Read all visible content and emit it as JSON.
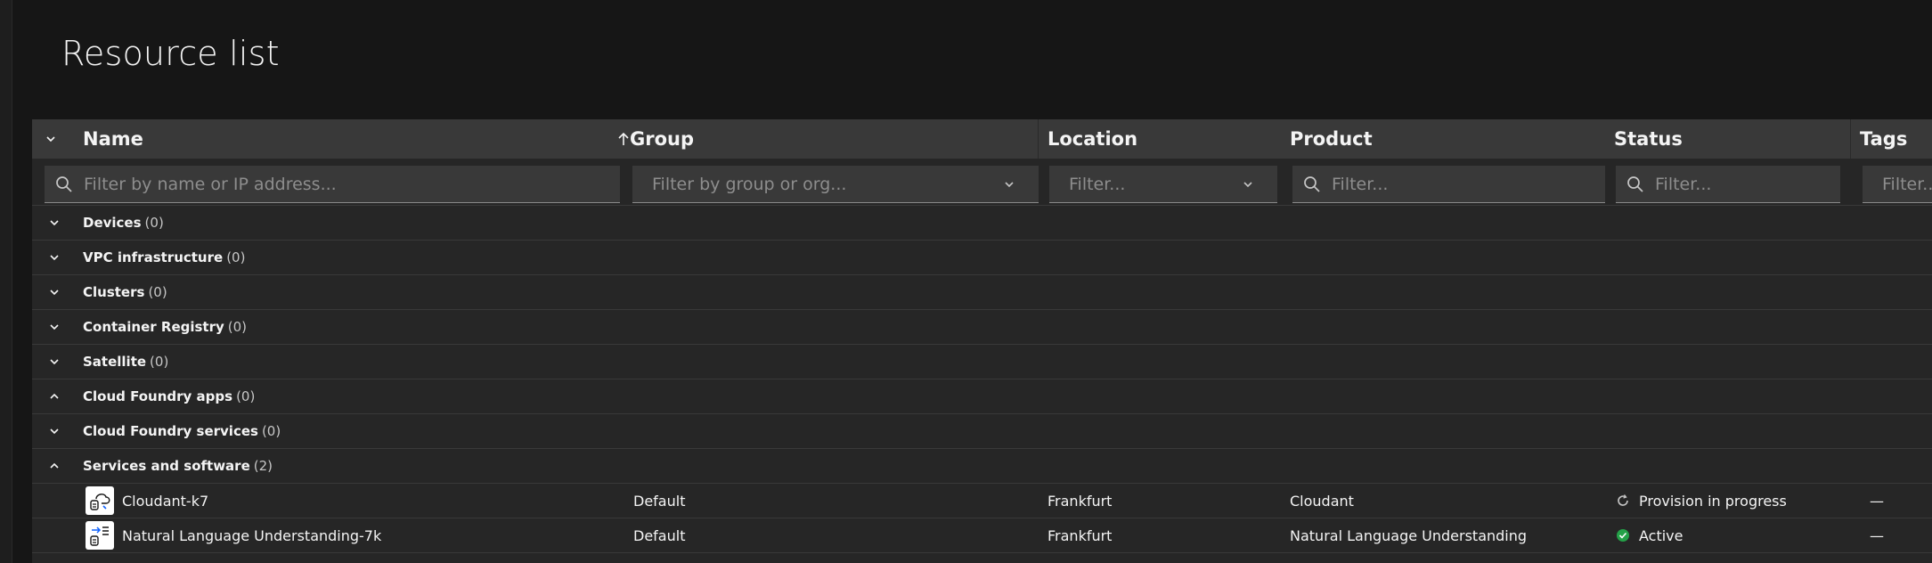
{
  "page": {
    "title": "Resource list"
  },
  "columns": {
    "name": "Name",
    "group": "Group",
    "location": "Location",
    "product": "Product",
    "status": "Status",
    "tags": "Tags"
  },
  "filters": {
    "name_placeholder": "Filter by name or IP address...",
    "group_placeholder": "Filter by group or org...",
    "location_placeholder": "Filter...",
    "product_placeholder": "Filter...",
    "status_placeholder": "Filter...",
    "tags_placeholder": "Filter..."
  },
  "groups": [
    {
      "label": "Devices",
      "count": "(0)",
      "expanded": false
    },
    {
      "label": "VPC infrastructure",
      "count": "(0)",
      "expanded": false
    },
    {
      "label": "Clusters",
      "count": "(0)",
      "expanded": false
    },
    {
      "label": "Container Registry",
      "count": "(0)",
      "expanded": false
    },
    {
      "label": "Satellite",
      "count": "(0)",
      "expanded": false
    },
    {
      "label": "Cloud Foundry apps",
      "count": "(0)",
      "expanded": true
    },
    {
      "label": "Cloud Foundry services",
      "count": "(0)",
      "expanded": false
    },
    {
      "label": "Services and software",
      "count": "(2)",
      "expanded": true
    }
  ],
  "resources": [
    {
      "name": "Cloudant-k7",
      "group": "Default",
      "location": "Frankfurt",
      "product": "Cloudant",
      "status": "Provision in progress",
      "status_icon": "progress-icon",
      "tags": "—"
    },
    {
      "name": "Natural Language Understanding-7k",
      "group": "Default",
      "location": "Frankfurt",
      "product": "Natural Language Understanding",
      "status": "Active",
      "status_icon": "check-circle-icon",
      "status_color": "#24a148",
      "tags": "—"
    }
  ],
  "colors": {
    "background": "#161616",
    "table": "#262626",
    "header": "#393939",
    "active": "#24a148"
  }
}
